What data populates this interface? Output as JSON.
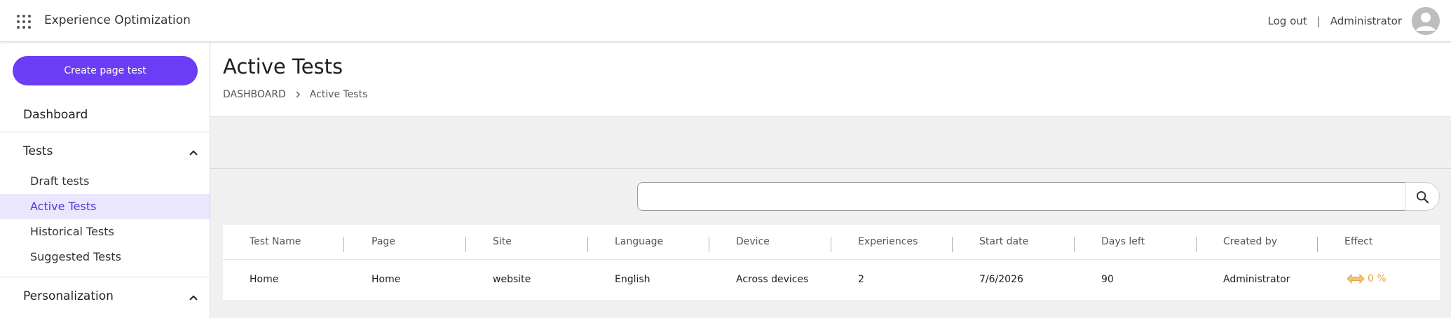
{
  "app": {
    "title": "Experience Optimization"
  },
  "header": {
    "logout_label": "Log out",
    "separator": "|",
    "user_name": "Administrator"
  },
  "sidebar": {
    "create_button_label": "Create page test",
    "dashboard_label": "Dashboard",
    "tests_label": "Tests",
    "test_items": [
      {
        "label": "Draft tests"
      },
      {
        "label": "Active Tests"
      },
      {
        "label": "Historical Tests"
      },
      {
        "label": "Suggested Tests"
      }
    ],
    "personalization_label": "Personalization"
  },
  "page": {
    "title": "Active Tests",
    "breadcrumb": {
      "root": "DASHBOARD",
      "current": "Active Tests"
    }
  },
  "search": {
    "value": "",
    "placeholder": ""
  },
  "table": {
    "columns": [
      "Test Name",
      "Page",
      "Site",
      "Language",
      "Device",
      "Experiences",
      "Start date",
      "Days left",
      "Created by",
      "Effect"
    ],
    "rows": [
      {
        "test_name": "Home",
        "page": "Home",
        "site": "website",
        "language": "English",
        "device": "Across devices",
        "experiences": "2",
        "start_date": "7/6/2026",
        "days_left": "90",
        "created_by": "Administrator",
        "effect": "0 %"
      }
    ]
  },
  "colors": {
    "accent": "#6b3df5",
    "active_bg": "#e9e6fd",
    "active_text": "#5a31d6",
    "effect": "#e8a43c"
  }
}
